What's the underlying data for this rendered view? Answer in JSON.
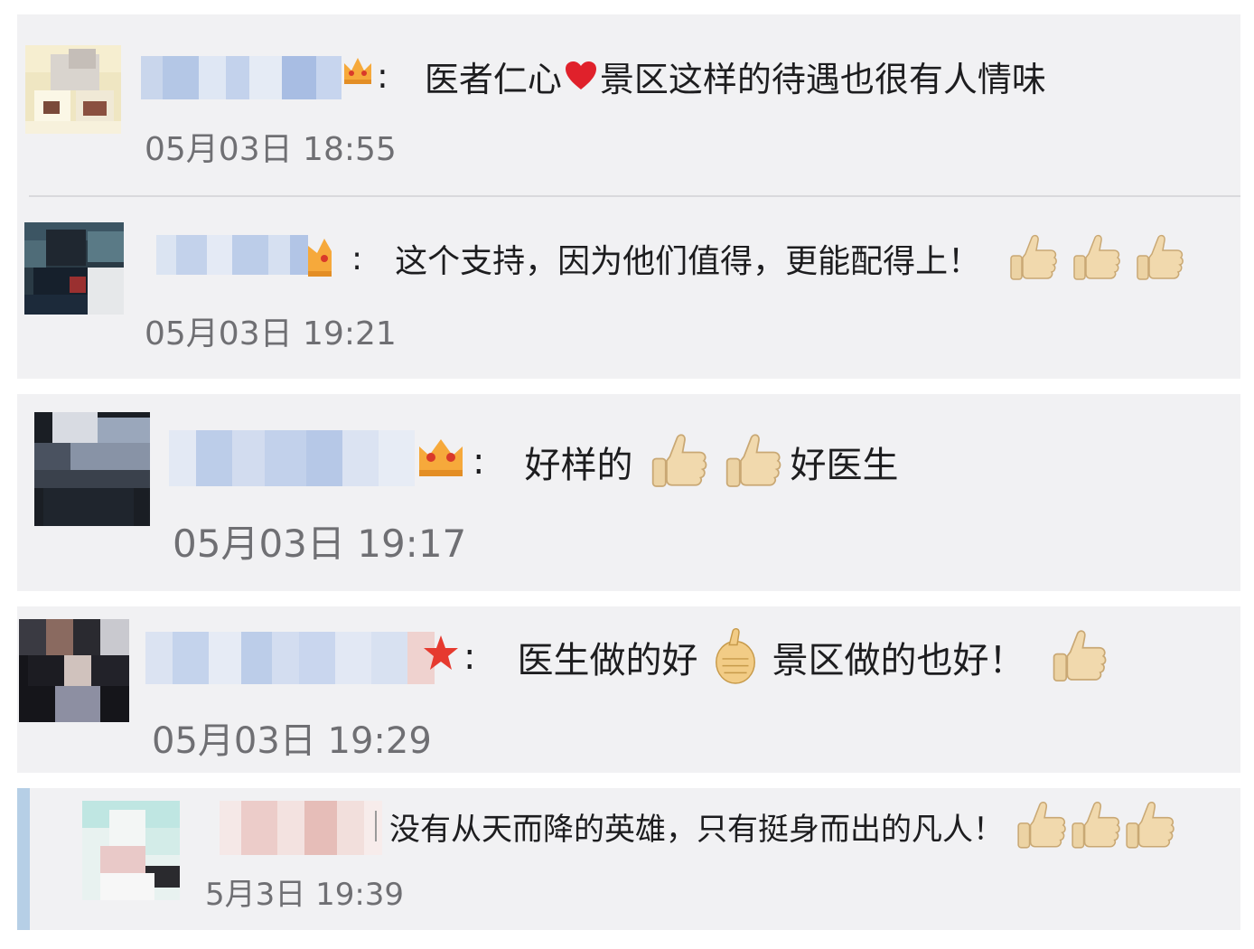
{
  "comments": [
    {
      "text_before": "医者仁心",
      "heart": "red-heart-emoji",
      "text_after": "景区这样的待遇也很有人情味",
      "colon": ":",
      "time": "05月03日 18:55",
      "badge": "crown-badge"
    },
    {
      "text": "这个支持，因为他们值得，更能配得上！",
      "colon": ":",
      "thumbs_count": 3,
      "time": "05月03日 19:21",
      "badge": "half-crown-badge"
    },
    {
      "text_before": "好样的",
      "thumbs_count": 2,
      "text_after": "好医生",
      "colon": ":",
      "time": "05月03日 19:17",
      "badge": "crown-badge"
    },
    {
      "text_before": "医生做的好",
      "text_middle": "景区做的也好！",
      "colon": ":",
      "time": "05月03日 19:29",
      "badge": "star-badge"
    },
    {
      "text": "没有从天而降的英雄，只有挺身而出的凡人！",
      "thumbs_count": 3,
      "time": "5月3日 19:39"
    }
  ],
  "colors": {
    "panel_bg": "#f1f1f3",
    "text": "#1d1d1f",
    "time": "#6f6f73",
    "divider": "#d9d9dc",
    "accent_bar": "#b6cfe6",
    "thumb": "#f1d9ad",
    "heart": "#e0212b",
    "crown": "#f6a93b"
  }
}
